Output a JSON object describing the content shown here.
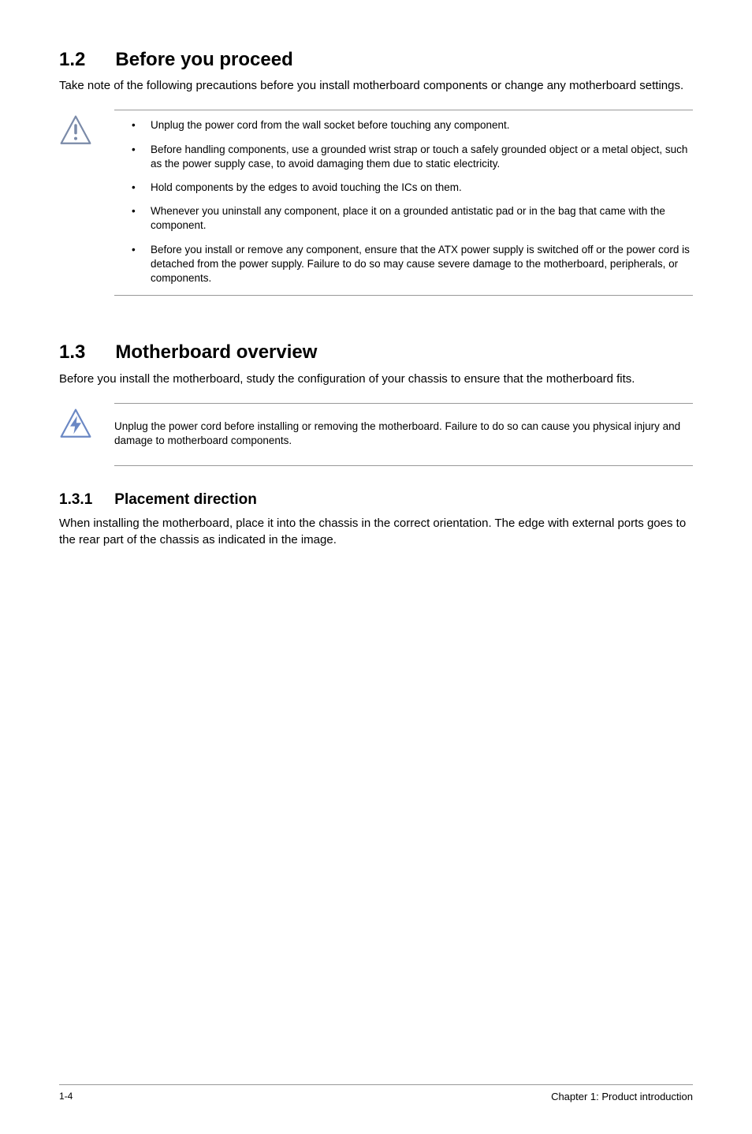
{
  "section12": {
    "number": "1.2",
    "title": "Before you proceed",
    "intro": "Take note of the following precautions before you install motherboard components or change any motherboard settings.",
    "bullets": [
      "Unplug the power cord from the wall socket before touching any component.",
      "Before handling components, use a grounded wrist strap or touch a safely grounded object or a metal object, such as the power supply case, to avoid damaging them due to static electricity.",
      "Hold components by the edges to avoid touching the ICs on them.",
      "Whenever you uninstall any component, place it on a grounded antistatic pad or in the bag that came with the component.",
      "Before you install or remove any component, ensure that the ATX power supply is switched off or the power cord is detached from the power supply. Failure to do so may cause severe damage to the motherboard, peripherals, or components."
    ]
  },
  "section13": {
    "number": "1.3",
    "title": "Motherboard overview",
    "intro": "Before you install the motherboard, study the configuration of your chassis to ensure that the motherboard fits.",
    "note": "Unplug the power cord before installing or removing the motherboard. Failure to do so can cause you physical injury and damage to motherboard components."
  },
  "section131": {
    "number": "1.3.1",
    "title": "Placement direction",
    "intro": "When installing the motherboard, place it into the chassis in the correct orientation. The edge with external ports goes to the rear part of the chassis as indicated in the image."
  },
  "footer": {
    "page": "1-4",
    "chapter": "Chapter 1: Product introduction"
  }
}
